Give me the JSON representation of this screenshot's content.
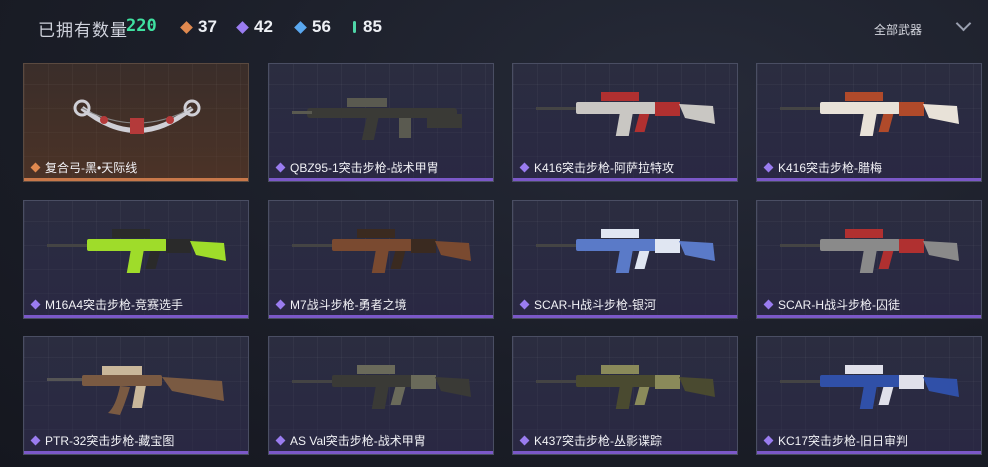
{
  "header": {
    "owned_label": "已拥有数量",
    "owned_count": "220",
    "stats": [
      {
        "value": "37",
        "color": "#e0894f",
        "icon": "orange-diamond-icon"
      },
      {
        "value": "42",
        "color": "#9a7cf0",
        "icon": "purple-diamond-icon"
      },
      {
        "value": "56",
        "color": "#5aa8f0",
        "icon": "blue-diamond-icon"
      },
      {
        "value": "85",
        "color": "#4fd6a8",
        "icon": "green-diamond-icon"
      }
    ],
    "filter_label": "全部武器"
  },
  "items": [
    {
      "name": "复合弓-黑•天际线",
      "rarity": "orange",
      "body": "#cfcfd6",
      "accent": "#b43a3a",
      "kind": "bow"
    },
    {
      "name": "QBZ95-1突击步枪-战术甲胄",
      "rarity": "purple",
      "body": "#3a3a36",
      "accent": "#5a5a50",
      "kind": "bullpup"
    },
    {
      "name": "K416突击步枪-阿萨拉特攻",
      "rarity": "purple",
      "body": "#c9c7c3",
      "accent": "#b03030",
      "kind": "rifle"
    },
    {
      "name": "K416突击步枪-腊梅",
      "rarity": "purple",
      "body": "#e8e2d8",
      "accent": "#b04a2a",
      "kind": "rifle"
    },
    {
      "name": "M16A4突击步枪-竞赛选手",
      "rarity": "purple",
      "body": "#9fdc2a",
      "accent": "#2a2a2a",
      "kind": "rifle"
    },
    {
      "name": "M7战斗步枪-勇者之境",
      "rarity": "purple",
      "body": "#7a4a30",
      "accent": "#3a2a20",
      "kind": "rifle"
    },
    {
      "name": "SCAR-H战斗步枪-银河",
      "rarity": "purple",
      "body": "#5a7ac8",
      "accent": "#e0e6f2",
      "kind": "rifle"
    },
    {
      "name": "SCAR-H战斗步枪-囚徒",
      "rarity": "purple",
      "body": "#8a8a8a",
      "accent": "#b03030",
      "kind": "rifle"
    },
    {
      "name": "PTR-32突击步枪-藏宝图",
      "rarity": "purple",
      "body": "#7a5a42",
      "accent": "#c9b79a",
      "kind": "ak"
    },
    {
      "name": "AS Val突击步枪-战术甲胄",
      "rarity": "purple",
      "body": "#3a3a36",
      "accent": "#6a6a5a",
      "kind": "rifle"
    },
    {
      "name": "K437突击步枪-丛影谍踪",
      "rarity": "purple",
      "body": "#4a4a30",
      "accent": "#8a8a5a",
      "kind": "rifle"
    },
    {
      "name": "KC17突击步枪-旧日审判",
      "rarity": "purple",
      "body": "#3050a8",
      "accent": "#e0e0ea",
      "kind": "rifle"
    }
  ]
}
